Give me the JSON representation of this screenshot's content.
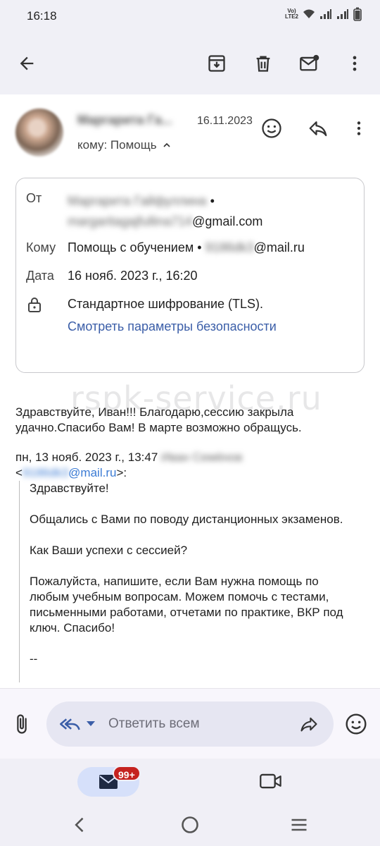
{
  "status_bar": {
    "time": "16:18",
    "lte_top": "Vo)",
    "lte_bottom": "LTE2"
  },
  "toolbar": {
    "back": "arrow-left-icon",
    "archive": "archive-icon",
    "delete": "trash-icon",
    "mark_unread": "mail-unread-icon",
    "more": "more-vert-icon"
  },
  "email": {
    "sender_name": "Маргарита Га...",
    "date": "16.11.2023",
    "to_line": "кому: Помощь",
    "details": {
      "from_label": "От",
      "from_name": "Маргарита Гайфуллина",
      "from_sep": "•",
      "from_email_local": "margaritagajfullina714",
      "from_email_domain": "@gmail.com",
      "to_label": "Кому",
      "to_name": "Помощь с обучением",
      "to_sep": "•",
      "to_email_local": "9186dk3",
      "to_email_domain": "@mail.ru",
      "date_label": "Дата",
      "date_value": "16 нояб. 2023 г., 16:20",
      "encryption_text": "Стандартное шифрование (TLS).",
      "security_link": "Смотреть параметры безопасности"
    },
    "body_line1": "Здравствуйте, Иван!!! Благодарю,сессию закрыла",
    "body_line2": "удачно.Спасибо Вам! В марте возможно обращусь.",
    "quote_header": "пн, 13 нояб. 2023 г., 13:47",
    "quote_author": "Иван Семёнов",
    "quote_email_open": "<",
    "quote_email_local": "9186dk3",
    "quote_email_domain": "@mail.ru",
    "quote_email_close": ">:",
    "quote_p1": "Здравствуйте!",
    "quote_p2": "Общались с Вами по поводу дистанционных экзаменов.",
    "quote_p3": "Как Ваши успехи с сессией?",
    "quote_p4": "Пожалуйста, напишите, если Вам нужна помощь по любым учебным вопросам. Можем помочь с тестами, письменными работами, отчетами по практике, ВКР под ключ. Спасибо!",
    "quote_sig": "--"
  },
  "watermark": "rspk-service.ru",
  "reply": {
    "placeholder": "Ответить всем"
  },
  "bottom_nav": {
    "badge": "99+"
  },
  "colors": {
    "accent": "#3b5ea8",
    "badge": "#c5221f",
    "link": "#3b7bd4"
  }
}
